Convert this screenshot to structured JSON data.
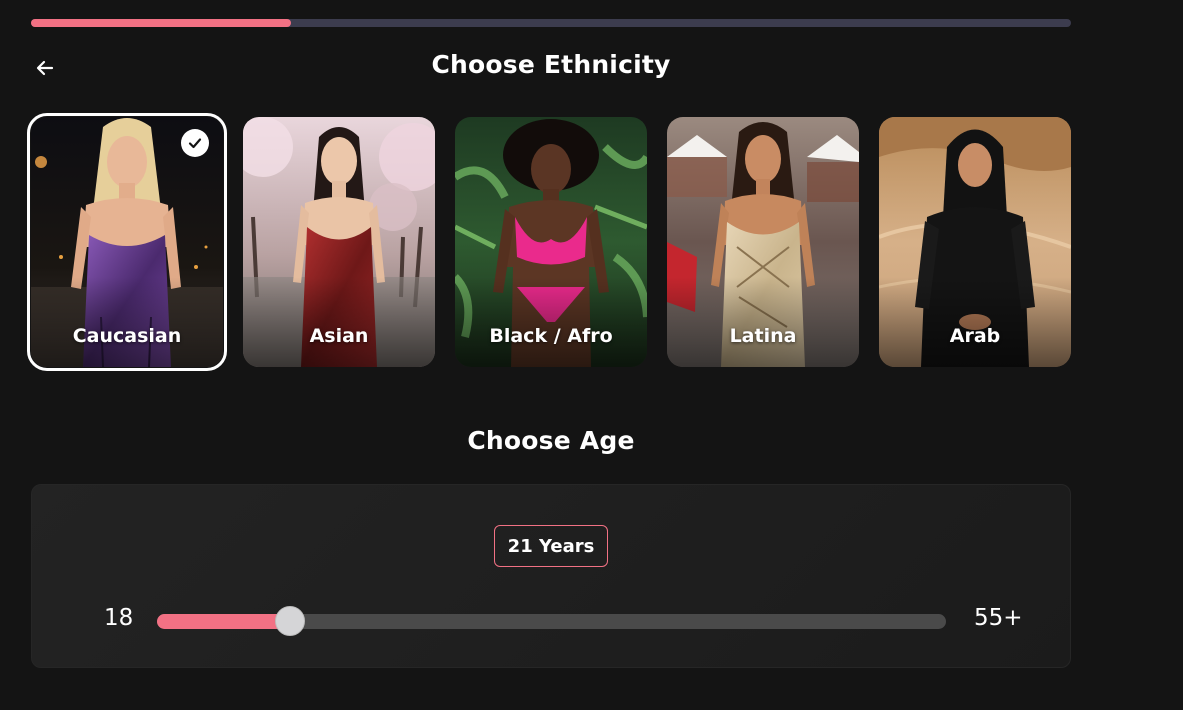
{
  "progress": {
    "fraction": 0.25,
    "color": "#f27184"
  },
  "header": {
    "back_icon": "arrow-left-icon",
    "title": "Choose Ethnicity"
  },
  "ethnicities": [
    {
      "label": "Caucasian",
      "selected": true
    },
    {
      "label": "Asian",
      "selected": false
    },
    {
      "label": "Black / Afro",
      "selected": false
    },
    {
      "label": "Latina",
      "selected": false
    },
    {
      "label": "Arab",
      "selected": false
    }
  ],
  "age_section": {
    "title": "Choose Age",
    "value_label": "21 Years",
    "min_label": "18",
    "max_label": "55+",
    "min_value": 18,
    "max_value": 55,
    "value": 21
  },
  "colors": {
    "accent": "#f27184",
    "background": "#141414",
    "track": "#4a4a4a"
  }
}
